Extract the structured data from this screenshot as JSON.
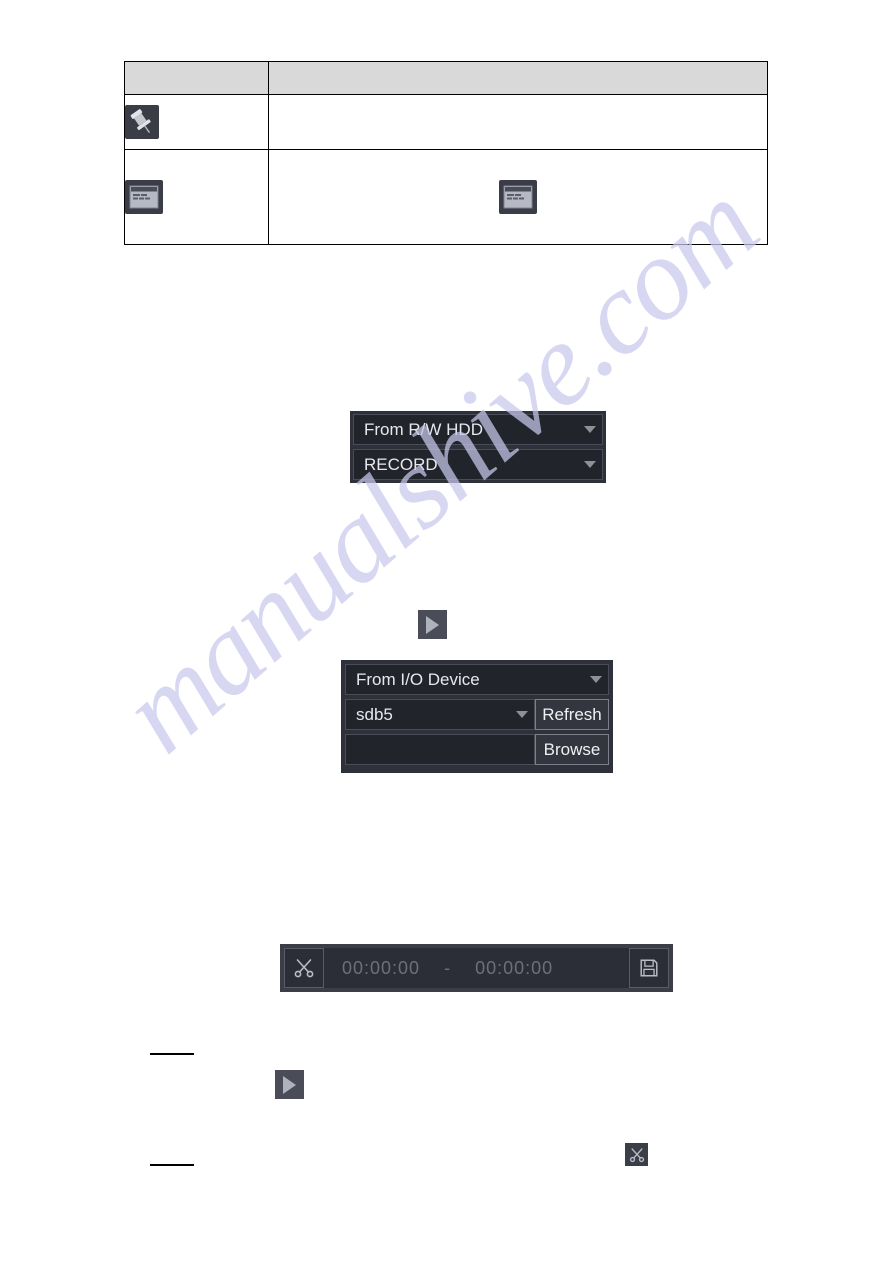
{
  "page": {
    "watermark": "manualshive.com",
    "background_color": "#ffffff"
  },
  "spec_table": {
    "columns": [
      "",
      ""
    ],
    "header": {
      "col1": "",
      "col2": ""
    },
    "rows": [
      {
        "icon": "pushpin-icon",
        "icon_label": "",
        "description": "",
        "description_icon": ""
      },
      {
        "icon": "window-dialog-icon",
        "icon_label": "",
        "description": "",
        "description_icon": "window-dialog-icon"
      }
    ]
  },
  "source_panel": {
    "record_source_select": {
      "value": "From R/W HDD",
      "caret": "chevron-down-icon"
    },
    "record_type_select": {
      "value": "RECORD",
      "caret": "chevron-down-icon"
    }
  },
  "play_button_top": {
    "icon": "play-icon"
  },
  "io_panel": {
    "source_select": {
      "value": "From I/O Device",
      "caret": "chevron-down-icon"
    },
    "device_select": {
      "value": "sdb5",
      "caret": "chevron-down-icon"
    },
    "refresh_button": "Refresh",
    "path_input": {
      "value": "",
      "placeholder": ""
    },
    "browse_button": "Browse"
  },
  "clip_bar": {
    "clip_icon": "scissors-icon",
    "start_time": "00:00:00",
    "separator": "-",
    "end_time": "00:00:00",
    "save_icon": "save-floppy-icon"
  },
  "play_button_bottom": {
    "icon": "play-icon"
  },
  "scissors_inline": {
    "icon": "scissors-icon"
  },
  "colors": {
    "panel_bg": "#2f313a",
    "field_bg": "#22242b",
    "field_border": "#4a4d58",
    "button_bg": "#33363f",
    "button_border": "#7d808a",
    "text": "#e8e8ec",
    "muted_text": "#6d7079",
    "table_header_bg": "#d9d9d9",
    "watermark": "#c9c9ee"
  }
}
